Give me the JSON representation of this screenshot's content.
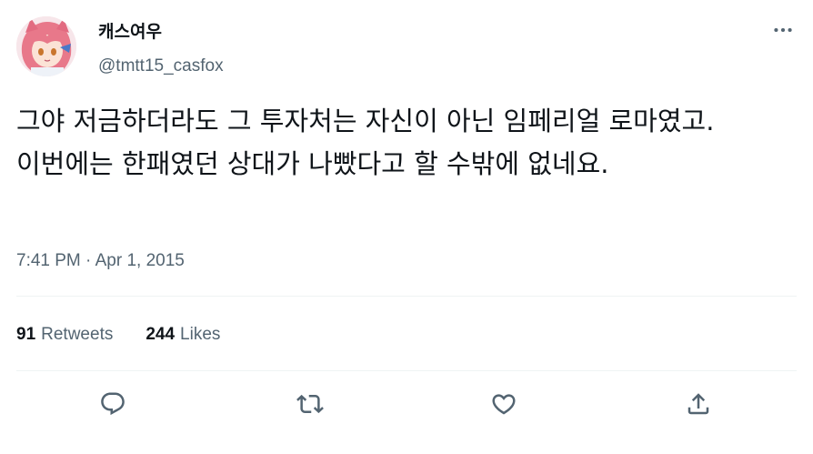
{
  "author": {
    "display_name": "캐스여우",
    "handle": "@tmtt15_casfox"
  },
  "tweet": {
    "text": "그야 저금하더라도 그 투자처는 자신이 아닌 임페리얼 로마였고. 이번에는 한패였던 상대가 나빴다고 할 수밖에 없네요.",
    "timestamp": "7:41 PM · Apr 1, 2015"
  },
  "stats": {
    "retweets_count": "91",
    "retweets_label": "Retweets",
    "likes_count": "244",
    "likes_label": "Likes"
  },
  "icons": {
    "more": "more-icon",
    "reply": "reply-icon",
    "retweet": "retweet-icon",
    "like": "heart-icon",
    "share": "share-icon"
  },
  "colors": {
    "text_primary": "#0f1419",
    "text_secondary": "#536471",
    "divider": "#eff3f4"
  }
}
